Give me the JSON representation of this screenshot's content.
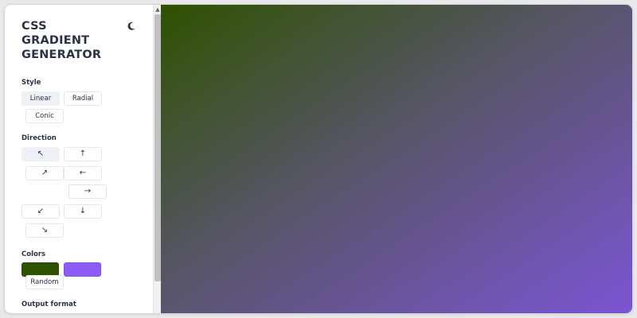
{
  "app": {
    "title": "CSS GRADIENT GENERATOR",
    "title_lines": [
      "CSS",
      "GRADIENT",
      "GENERATOR"
    ]
  },
  "sections": {
    "style": "Style",
    "direction": "Direction",
    "colors": "Colors",
    "output_format": "Output format"
  },
  "style_buttons": [
    {
      "label": "Linear",
      "active": true
    },
    {
      "label": "Radial",
      "active": false
    },
    {
      "label": "Conic",
      "active": false
    }
  ],
  "direction_buttons": [
    {
      "glyph": "↖",
      "icon": "arrow-up-left-icon",
      "active": true
    },
    {
      "glyph": "↑",
      "icon": "arrow-up-icon",
      "active": false
    },
    {
      "glyph": "↗",
      "icon": "arrow-up-right-icon",
      "active": false
    },
    {
      "glyph": "←",
      "icon": "arrow-left-icon",
      "active": false
    },
    {
      "glyph": "→",
      "icon": "arrow-right-icon",
      "active": false
    },
    {
      "glyph": "↙",
      "icon": "arrow-down-left-icon",
      "active": false
    },
    {
      "glyph": "↓",
      "icon": "arrow-down-icon",
      "active": false
    },
    {
      "glyph": "↘",
      "icon": "arrow-down-right-icon",
      "active": false
    }
  ],
  "colors": {
    "stops": [
      "#2f5200",
      "#8b5cf6"
    ],
    "random_label": "Random"
  },
  "theme": {
    "toggle_icon": "moon-icon",
    "text_color": "#2a3345",
    "gradient_mid": "#575566",
    "gradient_end": "#7b55d4"
  }
}
